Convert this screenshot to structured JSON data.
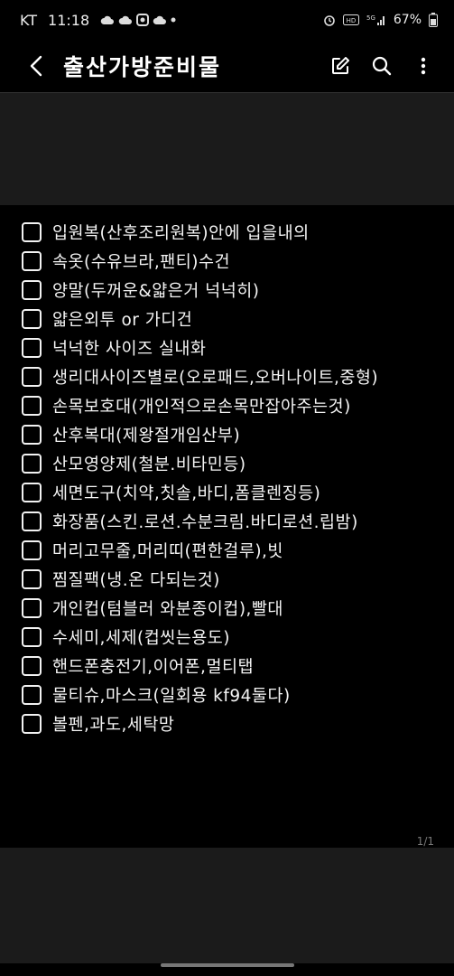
{
  "status_bar": {
    "carrier": "KT",
    "time": "11:18",
    "network": "5G",
    "battery": "67%"
  },
  "app_bar": {
    "title": "출산가방준비물",
    "icons": [
      "back-icon",
      "edit-icon",
      "search-icon",
      "more-vert-icon"
    ]
  },
  "checklist": {
    "items": [
      "입원복(산후조리원복)안에 입을내의",
      "속옷(수유브라,팬티)수건",
      "양말(두꺼운&얇은거 넉넉히)",
      "얇은외투 or 가디건",
      "넉넉한 사이즈 실내화",
      "생리대사이즈별로(오로패드,오버나이트,중형)",
      "손목보호대(개인적으로손목만잡아주는것)",
      "산후복대(제왕절개임산부)",
      "산모영양제(철분.비타민등)",
      "세면도구(치약,칫솔,바디,폼클렌징등)",
      "화장품(스킨.로션.수분크림.바디로션.립밤)",
      "머리고무줄,머리띠(편한걸루),빗",
      "찜질팩(냉.온 다되는것)",
      "개인컵(텀블러 와분종이컵),빨대",
      "수세미,세제(컵씻는용도)",
      "핸드폰충전기,이어폰,멀티탭",
      "물티슈,마스크(일회용 kf94둘다)",
      "볼펜,과도,세탁망"
    ]
  },
  "page_indicator": "1/1"
}
